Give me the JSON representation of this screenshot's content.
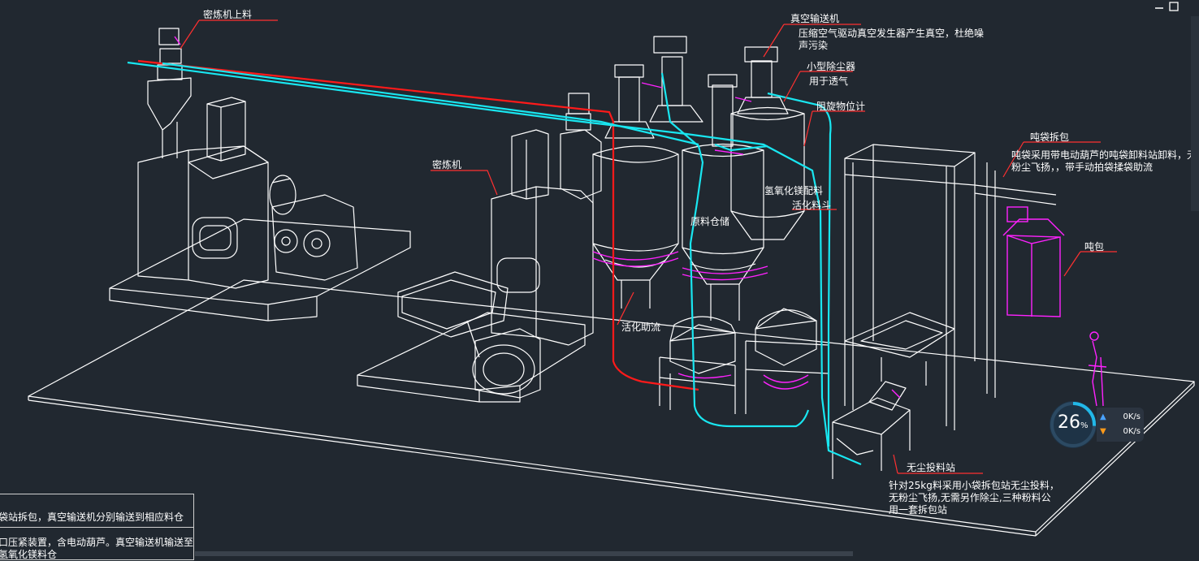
{
  "labels": {
    "mixer_feed": "密炼机上料",
    "vacuum_conveyor": "真空输送机",
    "vacuum_desc_1": "压缩空气驱动真空发生器产生真空，杜绝噪",
    "vacuum_desc_2": "声污染",
    "small_dust_collector": "小型除尘器",
    "for_venting": "用于透气",
    "rotary_level_meter": "阻旋物位计",
    "ton_bag_unpack": "吨袋拆包",
    "ton_bag_desc_1": "吨袋采用带电动葫芦的吨袋卸料站卸料，无",
    "ton_bag_desc_2": "粉尘飞扬，，带手动拍袋揉袋助流",
    "mixer": "密炼机",
    "mg_hydroxide_mix": "氢氧化镁配料",
    "activated_mix": "活化料斗",
    "raw_storage": "原料仓储",
    "ton_bag": "吨包",
    "flow_aid": "活化助流",
    "dustfree_station": "无尘投料站",
    "dustfree_desc_1": "针对25kg料采用小袋拆包站无尘投料，",
    "dustfree_desc_2": "无粉尘飞扬,无需另作除尘,三种粉料公",
    "dustfree_desc_3": "用一套拆包站"
  },
  "info_box": {
    "line1": "袋站拆包，真空输送机分别输送到相应料仓",
    "line2": "口压紧装置，含电动葫芦。真空输送机输送至",
    "line3": "氢氧化镁料仓"
  },
  "net_widget": {
    "percent": "26",
    "percent_unit": "%",
    "up": "0K/s",
    "down": "0K/s"
  },
  "colors": {
    "background": "#212830",
    "line_white": "#ffffff",
    "pipe_cyan": "#19e6f0",
    "pipe_red": "#ff1a1a",
    "highlight_magenta": "#ff22ff",
    "leader_red": "#ff3030"
  },
  "icons": {
    "window_minimize": "minimize-icon",
    "window_close": "close-icon",
    "upload": "arrow-up-icon",
    "download": "arrow-down-icon"
  }
}
